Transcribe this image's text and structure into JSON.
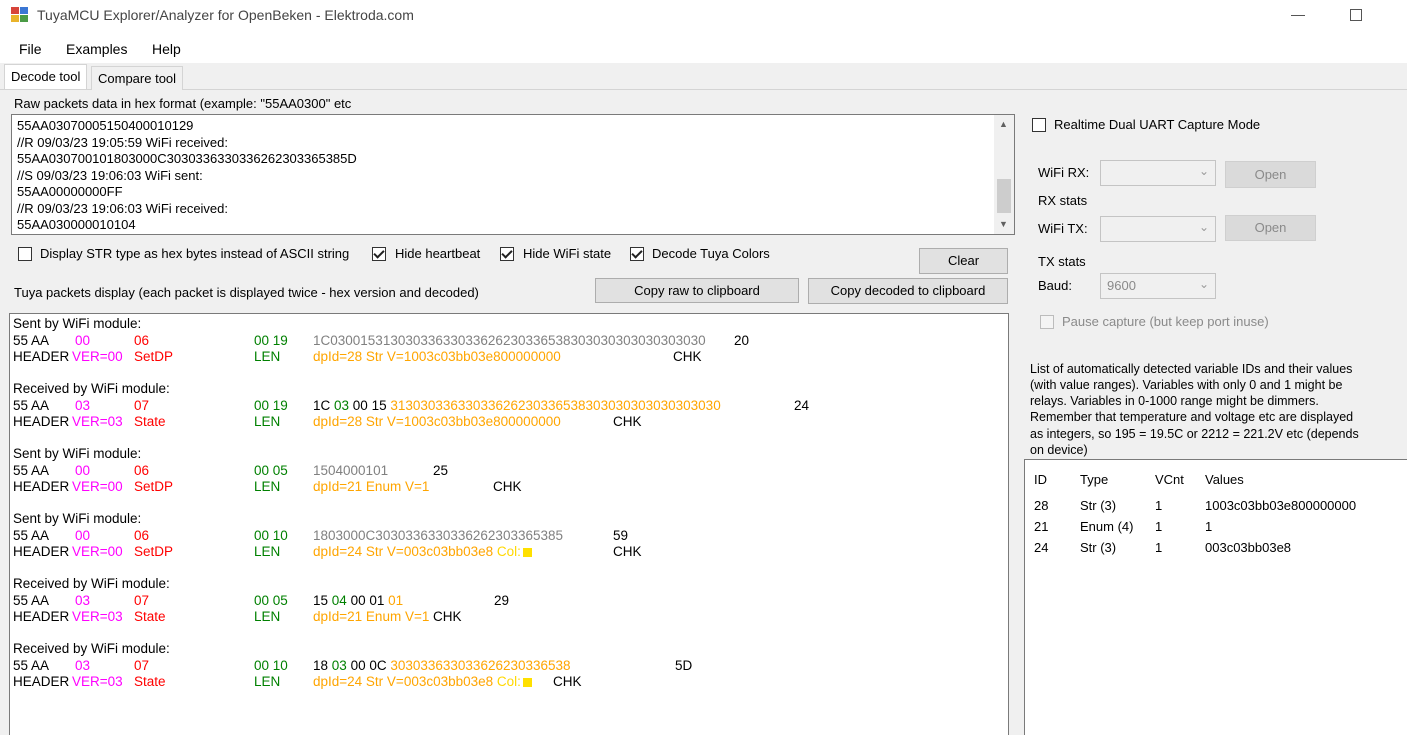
{
  "window": {
    "title": "TuyaMCU Explorer/Analyzer for OpenBeken - Elektroda.com"
  },
  "menu": [
    "File",
    "Examples",
    "Help"
  ],
  "tabs": [
    "Decode tool",
    "Compare tool"
  ],
  "raw": {
    "label": "Raw packets data in hex format (example: \"55AA0300\" etc",
    "lines": [
      "55AA03070005150400010129",
      "//R 09/03/23 19:05:59 WiFi received:",
      "55AA030700101803000C3030336330336262303365385D",
      "//S 09/03/23 19:06:03 WiFi sent:",
      "55AA00000000FF",
      "//R 09/03/23 19:06:03 WiFi received:",
      "55AA030000010104"
    ]
  },
  "options": {
    "display_str_hex": "Display STR type as hex bytes instead of ASCII string",
    "hide_heartbeat": "Hide heartbeat",
    "hide_wifi_state": "Hide WiFi state",
    "decode_colors": "Decode Tuya Colors"
  },
  "buttons": {
    "clear": "Clear",
    "copy_raw": "Copy raw to clipboard",
    "copy_decoded": "Copy decoded to clipboard"
  },
  "packets_label": "Tuya packets display (each packet is displayed twice - hex version and decoded)",
  "packets": [
    {
      "title": "Sent by WiFi module:",
      "ver": "00",
      "verlbl": "VER=00",
      "cmd": "06",
      "cmdlbl": "SetDP",
      "len": "00 19",
      "data_gray": "1C03001531303033633033626230336538303030303030303030",
      "data_plain": "",
      "data_colored": "",
      "chk": "20",
      "decoded": "dpId=28 Str V=1003c03bb03e800000000",
      "col_label": ""
    },
    {
      "title": "Received by WiFi module:",
      "ver": "03",
      "verlbl": "VER=03",
      "cmd": "07",
      "cmdlbl": "State",
      "len": "00 19",
      "data_gray": "",
      "data_plain": "1C 03 00 15",
      "data_colored": "31303033633033626230336538303030303030303030",
      "chk": "24",
      "decoded": "dpId=28 Str V=1003c03bb03e800000000",
      "col_label": ""
    },
    {
      "title": "Sent by WiFi module:",
      "ver": "00",
      "verlbl": "VER=00",
      "cmd": "06",
      "cmdlbl": "SetDP",
      "len": "00 05",
      "data_gray": "1504000101",
      "data_plain": "",
      "data_colored": "",
      "chk": "25",
      "decoded": "dpId=21 Enum V=1",
      "col_label": ""
    },
    {
      "title": "Sent by WiFi module:",
      "ver": "00",
      "verlbl": "VER=00",
      "cmd": "06",
      "cmdlbl": "SetDP",
      "len": "00 10",
      "data_gray": "1803000C3030336330336262303365385",
      "data_plain": "",
      "data_colored": "",
      "chk": "59",
      "decoded": "dpId=24 Str V=003c03bb03e8",
      "col_label": "Col:"
    },
    {
      "title": "Received by WiFi module:",
      "ver": "03",
      "verlbl": "VER=03",
      "cmd": "07",
      "cmdlbl": "State",
      "len": "00 05",
      "data_gray": "",
      "data_plain": "15 04 00 01",
      "data_colored": "01",
      "chk": "29",
      "decoded": "dpId=21 Enum V=1",
      "col_label": ""
    },
    {
      "title": "Received by WiFi module:",
      "ver": "03",
      "verlbl": "VER=03",
      "cmd": "07",
      "cmdlbl": "State",
      "len": "00 10",
      "data_gray": "",
      "data_plain": "18 03 00 0C",
      "data_colored": "303033633033626230336538",
      "chk": "5D",
      "decoded": "dpId=24 Str V=003c03bb03e8",
      "col_label": "Col:"
    }
  ],
  "pk_common": {
    "header": "HEADER",
    "aa": "55 AA",
    "len_label": "LEN",
    "chk_label": "CHK"
  },
  "right": {
    "realtime_label": "Realtime Dual UART Capture Mode",
    "wifi_rx": "WiFi RX:",
    "rx_stats": "RX stats",
    "wifi_tx": "WiFi TX:",
    "tx_stats": "TX stats",
    "baud": "Baud:",
    "baud_value": "9600",
    "open": "Open",
    "pause_label": "Pause capture (but keep port inuse)",
    "info": [
      "List of automatically detected variable IDs  and their values",
      "(with value ranges). Variables with only 0 and 1 might be",
      "relays. Variables in 0-1000 range might be dimmers.",
      "Remember that temperature and voltage etc are displayed",
      "as integers, so 195 = 19.5C or 2212 = 221.2V etc (depends",
      "on device)"
    ],
    "columns": [
      "ID",
      "Type",
      "VCnt",
      "Values"
    ],
    "rows": [
      [
        "28",
        "Str (3)",
        "1",
        "1003c03bb03e800000000"
      ],
      [
        "21",
        "Enum (4)",
        "1",
        "1"
      ],
      [
        "24",
        "Str (3)",
        "1",
        "003c03bb03e8"
      ]
    ]
  }
}
